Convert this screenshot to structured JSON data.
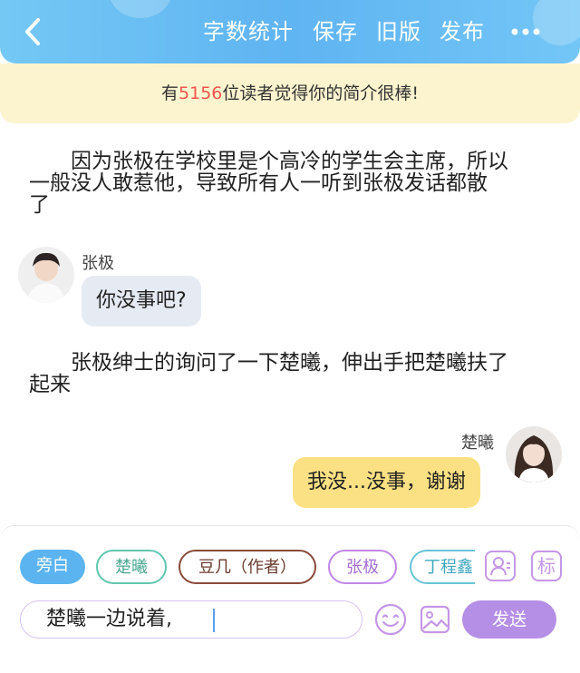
{
  "header": {
    "nav": {
      "word_count": "字数统计",
      "save": "保存",
      "old_version": "旧版",
      "publish": "发布"
    },
    "colors": {
      "accent": "#5fb4f2"
    }
  },
  "notice": {
    "prefix": "有",
    "count": "5156",
    "suffix": "位读者觉得你的简介很棒!"
  },
  "story": {
    "para1_line1": "因为张极在学校里是个高冷的学生会主席，所以",
    "para1_line2": "一般没人敢惹他，导致所有人一听到张极发话都散",
    "para1_line3": "了",
    "msg1_speaker": "张极",
    "msg1_text": "你没事吧?",
    "para2_line1": "张极绅士的询问了一下楚曦，伸出手把楚曦扶了",
    "para2_line2": "起来",
    "msg2_speaker": "楚曦",
    "msg2_text": "我没...没事，谢谢"
  },
  "composer": {
    "roles": [
      "旁白",
      "楚曦",
      "豆几（作者）",
      "张极",
      "丁程鑫"
    ],
    "tag_label": "标",
    "input_value": "楚曦一边说着,",
    "send_label": "发送"
  }
}
